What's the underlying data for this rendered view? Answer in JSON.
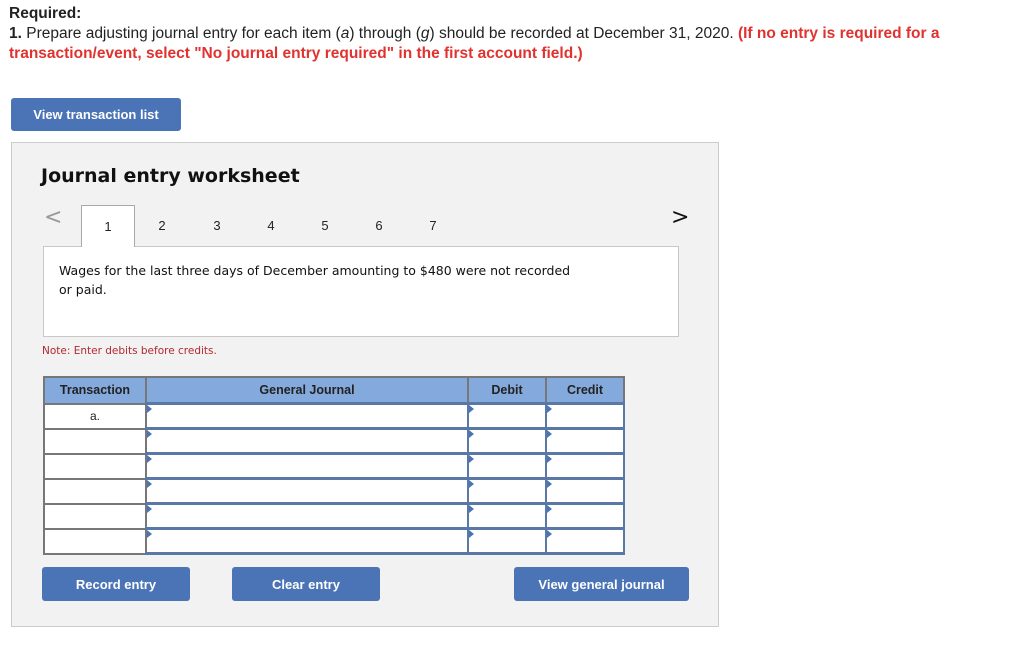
{
  "required": {
    "title": "Required:",
    "number": "1.",
    "text_part1": " Prepare adjusting journal entry for each item (",
    "item_a": "a",
    "text_part2": ") through (",
    "item_g": "g",
    "text_part3": ") should be recorded at December 31, 2020. ",
    "instruction": "(If no entry is required for a transaction/event, select \"No journal entry required\" in the first account field.)"
  },
  "buttons": {
    "view_transaction_list": "View transaction list",
    "record_entry": "Record entry",
    "clear_entry": "Clear entry",
    "view_general_journal": "View general journal"
  },
  "worksheet": {
    "title": "Journal entry worksheet",
    "nav_prev": "<",
    "nav_next": ">",
    "tabs": [
      "1",
      "2",
      "3",
      "4",
      "5",
      "6",
      "7"
    ],
    "active_tab": "1",
    "description": "Wages for the last three days of December amounting to $480 were not recorded or paid.",
    "note": "Note: Enter debits before credits."
  },
  "journal_table": {
    "headers": {
      "transaction": "Transaction",
      "general_journal": "General Journal",
      "debit": "Debit",
      "credit": "Credit"
    },
    "rows": [
      {
        "transaction": "a.",
        "account": "",
        "debit": "",
        "credit": ""
      },
      {
        "transaction": "",
        "account": "",
        "debit": "",
        "credit": ""
      },
      {
        "transaction": "",
        "account": "",
        "debit": "",
        "credit": ""
      },
      {
        "transaction": "",
        "account": "",
        "debit": "",
        "credit": ""
      },
      {
        "transaction": "",
        "account": "",
        "debit": "",
        "credit": ""
      },
      {
        "transaction": "",
        "account": "",
        "debit": "",
        "credit": ""
      }
    ]
  },
  "colors": {
    "button_blue": "#4a74b5",
    "header_blue": "#84a9dd",
    "instruction_red": "#e0322f",
    "note_red": "#b3282d"
  }
}
